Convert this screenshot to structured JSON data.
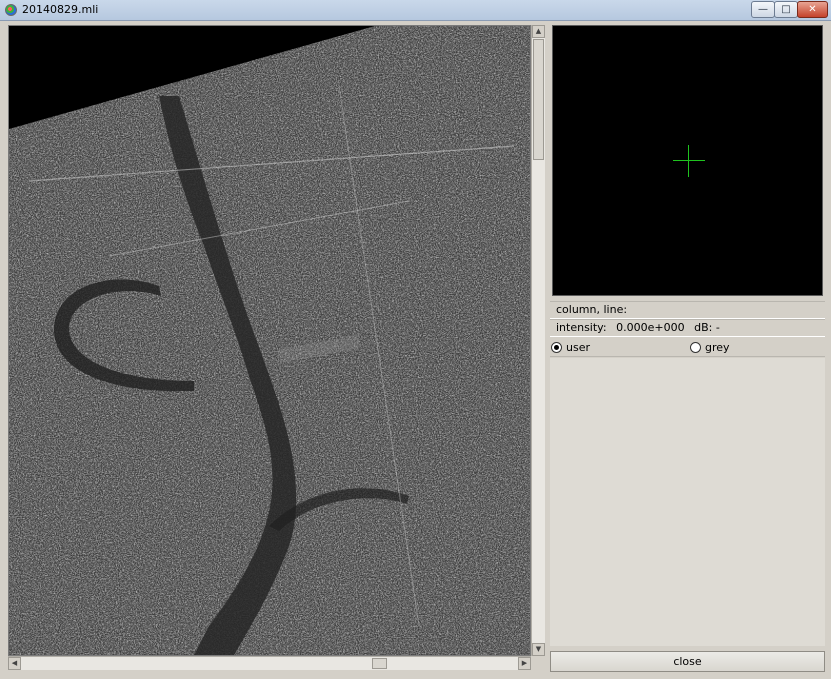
{
  "window": {
    "title": "20140829.mli",
    "controls": {
      "minimize": "—",
      "maximize": "□",
      "close": "✕"
    }
  },
  "scrollbars": {
    "vertical_position": 0.0,
    "horizontal_position": 0.72
  },
  "info": {
    "coord_label": "column, line:",
    "intensity_label": "intensity:",
    "intensity_value": "0.000e+000",
    "db_label": "dB: -"
  },
  "colormap": {
    "options": [
      {
        "label": "user",
        "checked": true
      },
      {
        "label": "grey",
        "checked": false
      }
    ]
  },
  "buttons": {
    "close_label": "close"
  },
  "colors": {
    "crosshair": "#1fc31f",
    "zoom_background": "#000000"
  },
  "icons": {
    "scroll_up": "▲",
    "scroll_down": "▼",
    "scroll_left": "◀",
    "scroll_right": "▶"
  }
}
